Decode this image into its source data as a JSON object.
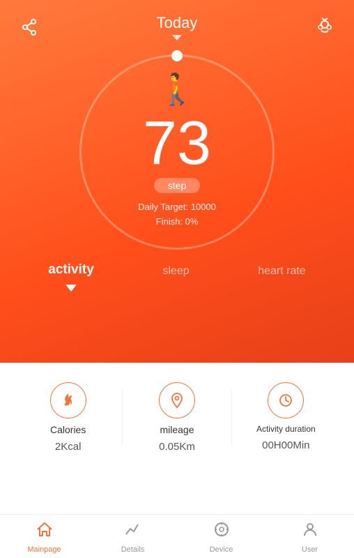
{
  "header": {
    "title": "Today",
    "share_icon": "share",
    "notification_icon": "bug"
  },
  "circle": {
    "step_count": "73",
    "step_label": "step",
    "daily_target_label": "Daily Target: 10000",
    "finish_label": "Finish: 0%"
  },
  "tabs": [
    {
      "id": "activity",
      "label": "activity",
      "active": true
    },
    {
      "id": "sleep",
      "label": "sleep",
      "active": false
    },
    {
      "id": "heart-rate",
      "label": "heart rate",
      "active": false
    }
  ],
  "metrics": [
    {
      "id": "calories",
      "icon": "🔥",
      "label": "Calories",
      "value": "2Kcal"
    },
    {
      "id": "mileage",
      "icon": "📍",
      "label": "mileage",
      "value": "0.05Km"
    },
    {
      "id": "duration",
      "icon": "⏱",
      "label": "Activity duration",
      "value": "00H00Min"
    }
  ],
  "bottom_nav": [
    {
      "id": "mainpage",
      "icon": "🏠",
      "label": "Mainpage",
      "active": true
    },
    {
      "id": "details",
      "icon": "📈",
      "label": "Details",
      "active": false
    },
    {
      "id": "device",
      "icon": "🧭",
      "label": "Device",
      "active": false
    },
    {
      "id": "user",
      "icon": "👤",
      "label": "User",
      "active": false
    }
  ]
}
